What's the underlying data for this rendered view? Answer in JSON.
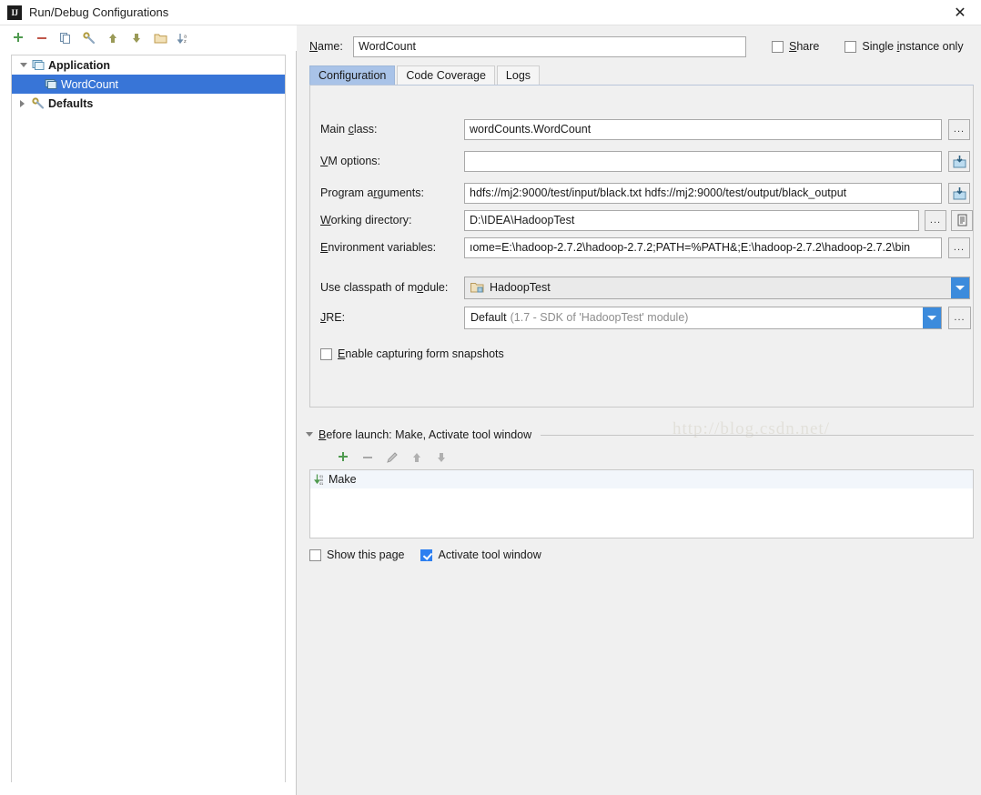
{
  "window": {
    "title": "Run/Debug Configurations",
    "app_icon": "IJ",
    "close_label": "✕"
  },
  "tree_toolbar": [
    {
      "name": "add-button",
      "glyph": "+",
      "color": "#4a9a4a"
    },
    {
      "name": "remove-button",
      "glyph": "−",
      "color": "#c55a4a"
    },
    {
      "name": "copy-button",
      "glyph": "copy-icon",
      "color": "#6a8fb5"
    },
    {
      "name": "edit-defaults-button",
      "glyph": "wrench-icon",
      "color": "#9a9a4a"
    },
    {
      "name": "move-up-button",
      "glyph": "↑",
      "color": "#9a9a4a"
    },
    {
      "name": "move-down-button",
      "glyph": "↓",
      "color": "#9a9a4a"
    },
    {
      "name": "new-folder-button",
      "glyph": "folder-icon",
      "color": "#c8a85a"
    },
    {
      "name": "sort-button",
      "glyph": "sort-az-icon",
      "color": "#6a8fb5"
    }
  ],
  "tree": {
    "nodes": [
      {
        "label": "Application",
        "level": 1,
        "expanded": true,
        "selected": false,
        "icon": "application-icon"
      },
      {
        "label": "WordCount",
        "level": 2,
        "expanded": null,
        "selected": true,
        "icon": "application-icon"
      },
      {
        "label": "Defaults",
        "level": 1,
        "expanded": false,
        "selected": false,
        "icon": "wrench-icon"
      }
    ]
  },
  "header": {
    "name_label": "Name:",
    "name_value": "WordCount",
    "share_label": "Share",
    "share_checked": false,
    "single_instance_label": "Single instance only",
    "single_instance_checked": false
  },
  "tabs": [
    {
      "label": "Configuration",
      "active": true
    },
    {
      "label": "Code Coverage",
      "active": false
    },
    {
      "label": "Logs",
      "active": false
    }
  ],
  "form": {
    "main_class": {
      "label": "Main class:",
      "value": "wordCounts.WordCount",
      "browse_label": "..."
    },
    "vm_options": {
      "label": "VM options:",
      "value": "",
      "expand_icon": "expand-editor-icon"
    },
    "program_arguments": {
      "label": "Program arguments:",
      "value": "hdfs://mj2:9000/test/input/black.txt hdfs://mj2:9000/test/output/black_output",
      "expand_icon": "expand-editor-icon"
    },
    "working_directory": {
      "label": "Working directory:",
      "value": "D:\\IDEA\\HadoopTest",
      "browse_label": "...",
      "macro_icon": "insert-macro-icon"
    },
    "environment_variables": {
      "label": "Environment variables:",
      "value": "ıome=E:\\hadoop-2.7.2\\hadoop-2.7.2;PATH=%PATH&;E:\\hadoop-2.7.2\\hadoop-2.7.2\\bin",
      "browse_label": "..."
    },
    "use_classpath_of_module": {
      "label": "Use classpath of module:",
      "value": "HadoopTest",
      "icon": "module-folder-icon"
    },
    "jre": {
      "label": "JRE:",
      "value": "Default",
      "hint": "(1.7 - SDK of 'HadoopTest' module)",
      "browse_label": "..."
    },
    "enable_capturing": {
      "label": "Enable capturing form snapshots",
      "checked": false
    }
  },
  "before_launch": {
    "header": "Before launch: Make, Activate tool window",
    "toolbar": [
      {
        "name": "add-task-button",
        "glyph": "+",
        "color": "#4a9a4a"
      },
      {
        "name": "remove-task-button",
        "glyph": "−",
        "color": "#a8a8a8"
      },
      {
        "name": "edit-task-button",
        "glyph": "pencil-icon",
        "color": "#9a9a9a"
      },
      {
        "name": "move-task-up-button",
        "glyph": "↑",
        "color": "#a8a8a8"
      },
      {
        "name": "move-task-down-button",
        "glyph": "↓",
        "color": "#a8a8a8"
      }
    ],
    "items": [
      {
        "label": "Make",
        "icon": "make-icon"
      }
    ],
    "show_this_page": {
      "label": "Show this page",
      "checked": false
    },
    "activate_tool_window": {
      "label": "Activate tool window",
      "checked": true
    }
  },
  "watermark": {
    "text": "http://blog.csdn.net/"
  },
  "colors": {
    "selection": "#3875d7",
    "accent": "#3c8bdc",
    "tab_active": "#a9c3e8",
    "panel": "#f0f0f0"
  }
}
